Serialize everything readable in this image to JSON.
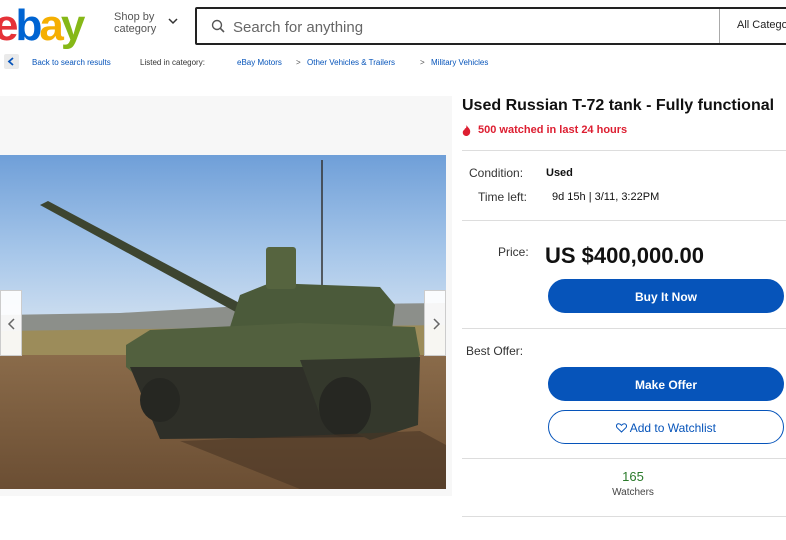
{
  "header": {
    "logo": {
      "e": "e",
      "b": "b",
      "a": "a",
      "y": "y"
    },
    "shop_by_line1": "Shop by",
    "shop_by_line2": "category",
    "search_placeholder": "Search for anything",
    "category_select": "All Categories"
  },
  "breadcrumb": {
    "back_label": "Back to search results",
    "listed_in": "Listed in category:",
    "items": [
      "eBay Motors",
      "Other Vehicles & Trailers",
      "Military Vehicles"
    ],
    "separator": ">"
  },
  "listing": {
    "title": "Used Russian T-72 tank - Fully functional",
    "watched_text": "500 watched in last 24 hours",
    "condition_label": "Condition:",
    "condition_value": "Used",
    "time_left_label": "Time left:",
    "time_left_value": "9d 15h  |  3/11, 3:22PM",
    "price_label": "Price:",
    "price_value": "US $400,000.00",
    "buy_now_label": "Buy It Now",
    "best_offer_label": "Best Offer:",
    "make_offer_label": "Make Offer",
    "watchlist_label": "Add to Watchlist",
    "watchers_count": "165",
    "watchers_label": "Watchers"
  },
  "colors": {
    "brand_blue": "#0654ba",
    "alert_red": "#dd1e31",
    "watch_green": "#2a7a2a"
  },
  "icons": [
    "chevron-down-icon",
    "search-icon",
    "chevron-left-icon",
    "flame-icon",
    "heart-icon",
    "chevron-right-icon"
  ]
}
